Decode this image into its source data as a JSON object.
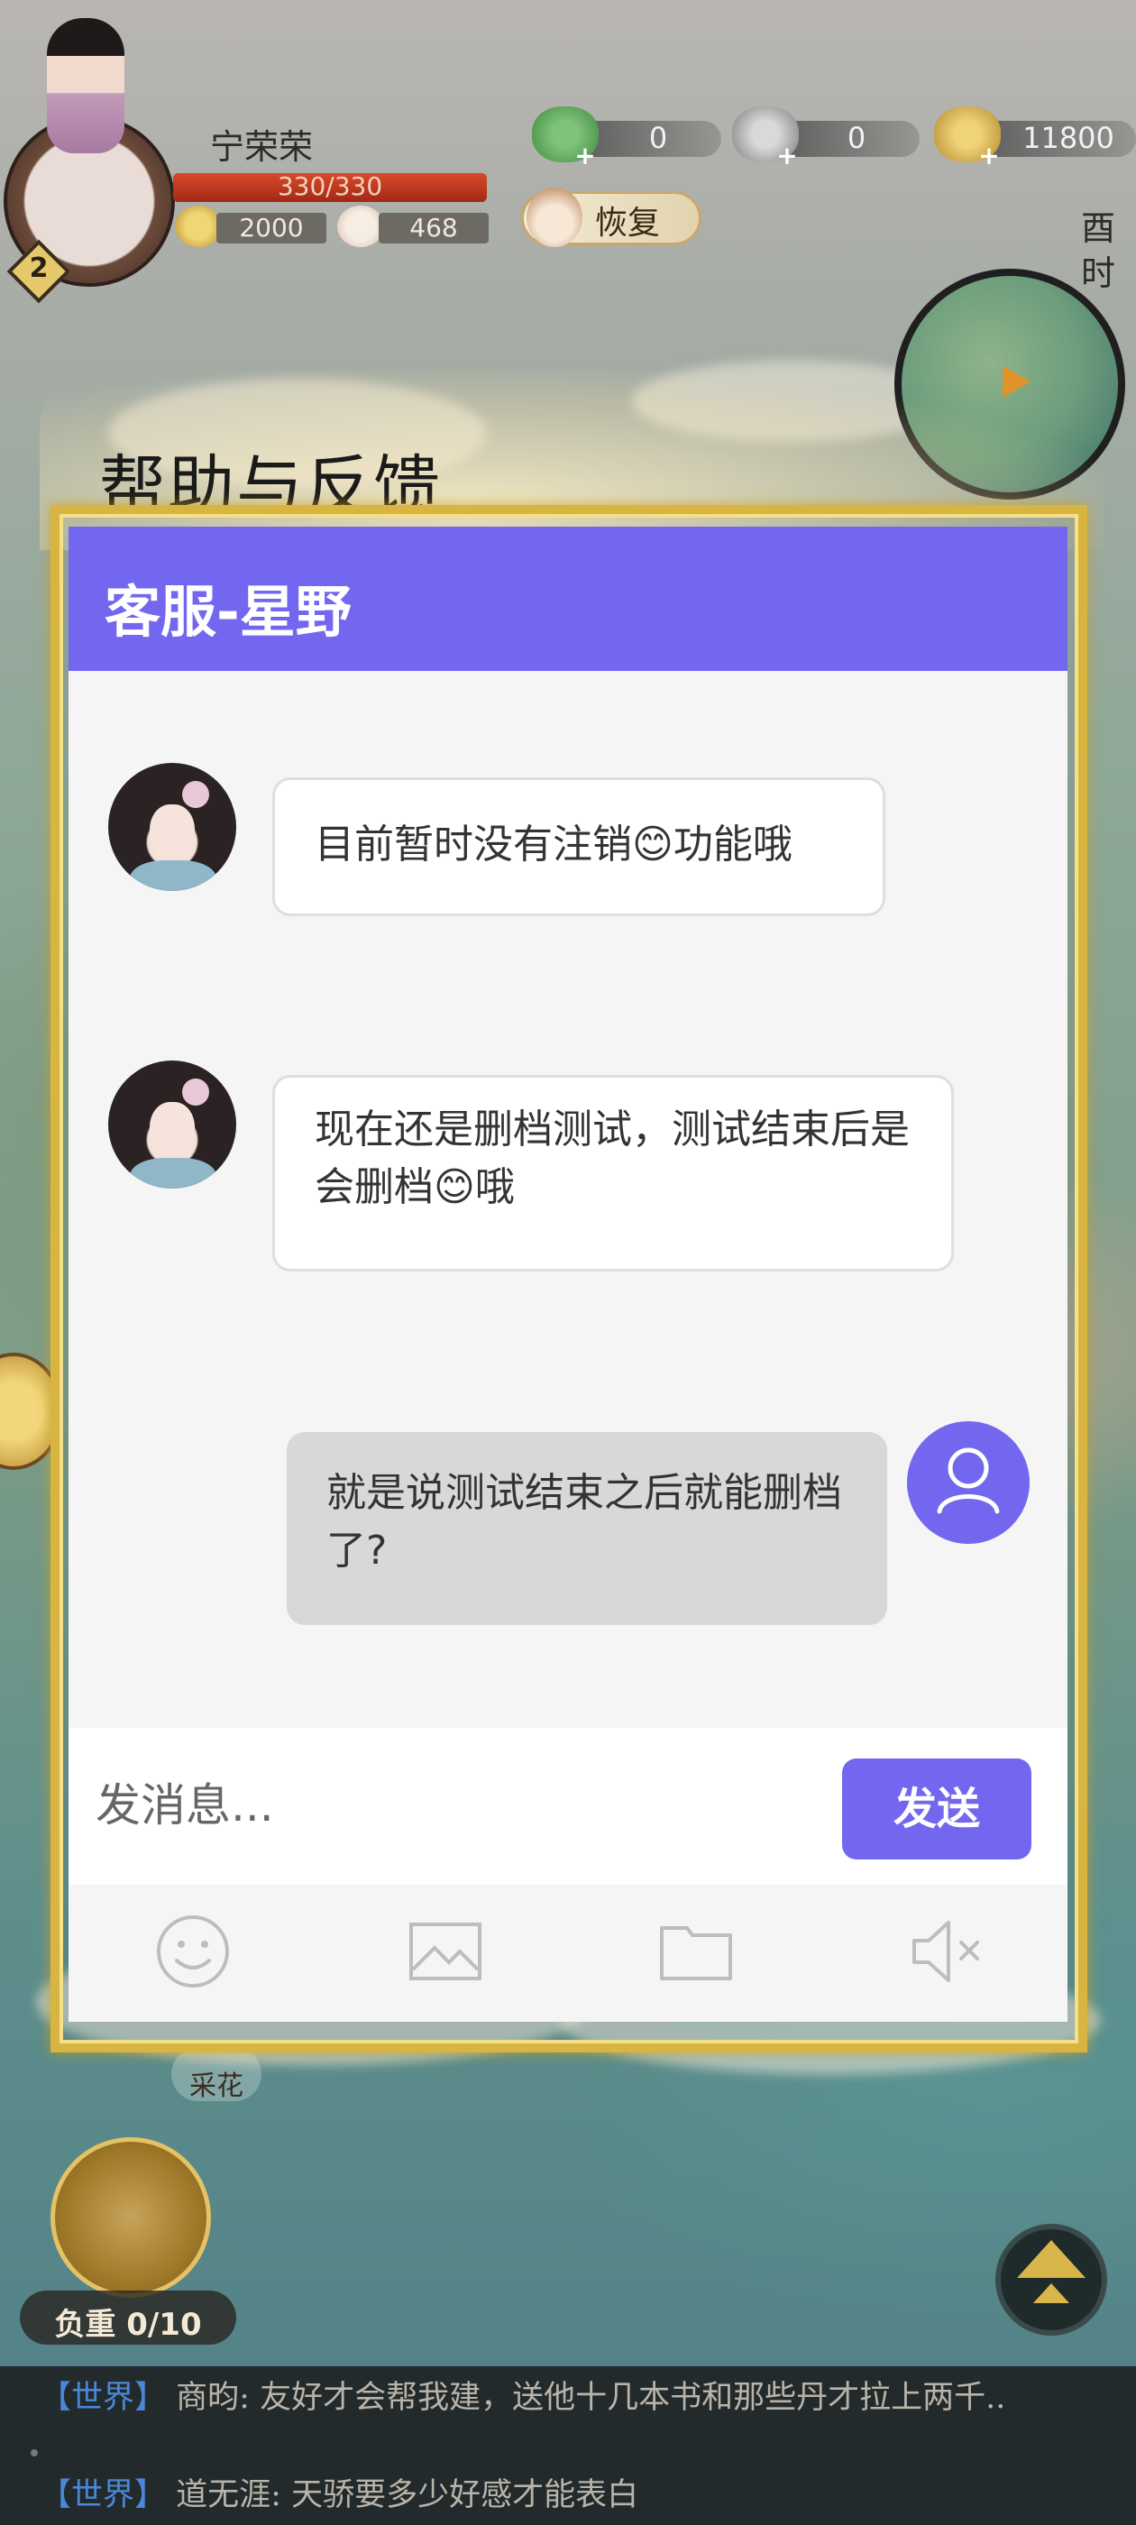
{
  "hud": {
    "player_name": "宁荣荣",
    "level": "2",
    "hp_text": "330/330",
    "hp_fraction": 1.0,
    "resource1": "2000",
    "resource2": "468",
    "currency1": "0",
    "currency2": "0",
    "currency3": "11800",
    "restore_label": "恢复",
    "time_label": "酉时"
  },
  "dialog": {
    "title": "帮助与反馈",
    "agent_name": "客服-星野",
    "messages": [
      {
        "from": "agent",
        "text": "目前暂时没有注销😊功能哦"
      },
      {
        "from": "agent",
        "text": "现在还是删档测试，测试结束后是会删档😊哦"
      },
      {
        "from": "user",
        "text": "就是说测试结束之后就能删档了?"
      }
    ],
    "input_placeholder": "发消息...",
    "send_label": "发送",
    "toolbar": [
      "emoji-icon",
      "image-icon",
      "folder-icon",
      "mute-icon"
    ]
  },
  "game": {
    "side_label": "采花",
    "load_label": "负重 0/10"
  },
  "world_chat": [
    {
      "channel": "【世界】",
      "text": "商昀: 友好才会帮我建，送他十几本书和那些丹才拉上两千.."
    },
    {
      "channel": "【世界】",
      "text": "道无涯: 天骄要多少好感才能表白"
    }
  ],
  "colors": {
    "accent": "#7367f0",
    "frame_gold": "#d8b540",
    "bubble_out": "#d8d8d8",
    "world_tag": "#4a87d8"
  }
}
